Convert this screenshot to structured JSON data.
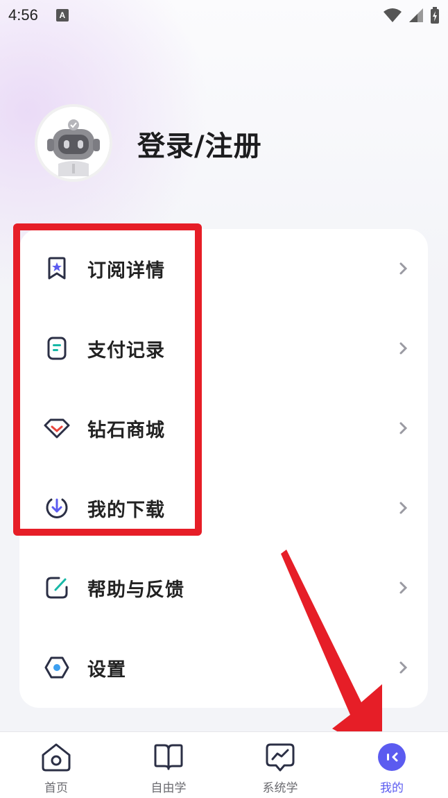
{
  "status_bar": {
    "time": "4:56",
    "badge": "A"
  },
  "profile": {
    "login_label": "登录/注册"
  },
  "menu": {
    "items": [
      {
        "label": "订阅详情",
        "icon": "bookmark-star-icon"
      },
      {
        "label": "支付记录",
        "icon": "receipt-icon"
      },
      {
        "label": "钻石商城",
        "icon": "diamond-icon"
      },
      {
        "label": "我的下载",
        "icon": "download-icon"
      },
      {
        "label": "帮助与反馈",
        "icon": "feedback-edit-icon"
      },
      {
        "label": "设置",
        "icon": "settings-hexagon-icon"
      }
    ]
  },
  "bottom_nav": {
    "items": [
      {
        "label": "首页",
        "icon": "home-icon",
        "active": false
      },
      {
        "label": "自由学",
        "icon": "book-icon",
        "active": false
      },
      {
        "label": "系统学",
        "icon": "chart-bubble-icon",
        "active": false
      },
      {
        "label": "我的",
        "icon": "profile-face-icon",
        "active": true
      }
    ]
  },
  "colors": {
    "accent": "#5b5bf0",
    "annotation_red": "#e61e27",
    "diamond_red": "#e8453c",
    "teal": "#17b8a6"
  }
}
